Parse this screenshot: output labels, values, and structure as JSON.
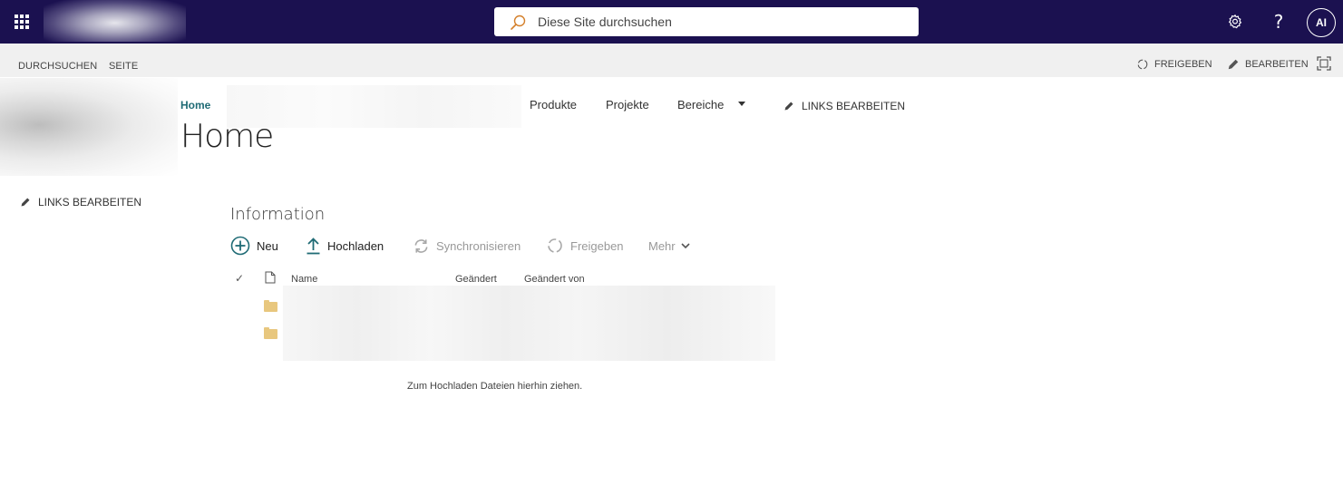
{
  "search": {
    "placeholder": "Diese Site durchsuchen"
  },
  "suite": {
    "avatar_initials": "AI",
    "help_label": "?"
  },
  "ribbon": {
    "tabs": [
      "DURCHSUCHEN",
      "SEITE"
    ],
    "share_label": "FREIGEBEN",
    "edit_label": "BEARBEITEN"
  },
  "topnav": {
    "home": "Home",
    "items": [
      "Produkte",
      "Projekte",
      "Bereiche"
    ],
    "edit_links": "LINKS BEARBEITEN"
  },
  "page": {
    "title": "Home"
  },
  "quicklaunch": {
    "edit_links": "LINKS BEARBEITEN"
  },
  "webpart": {
    "title": "Information",
    "commands": {
      "new": "Neu",
      "upload": "Hochladen",
      "sync": "Synchronisieren",
      "share": "Freigeben",
      "more": "Mehr"
    },
    "columns": {
      "name": "Name",
      "modified": "Geändert",
      "modified_by": "Geändert von"
    },
    "check_glyph": "✓",
    "drop_hint": "Zum Hochladen Dateien hierhin ziehen."
  },
  "colors": {
    "suite_bar": "#1b1150",
    "accent": "#1f6b75",
    "folder": "#e8c77e"
  }
}
